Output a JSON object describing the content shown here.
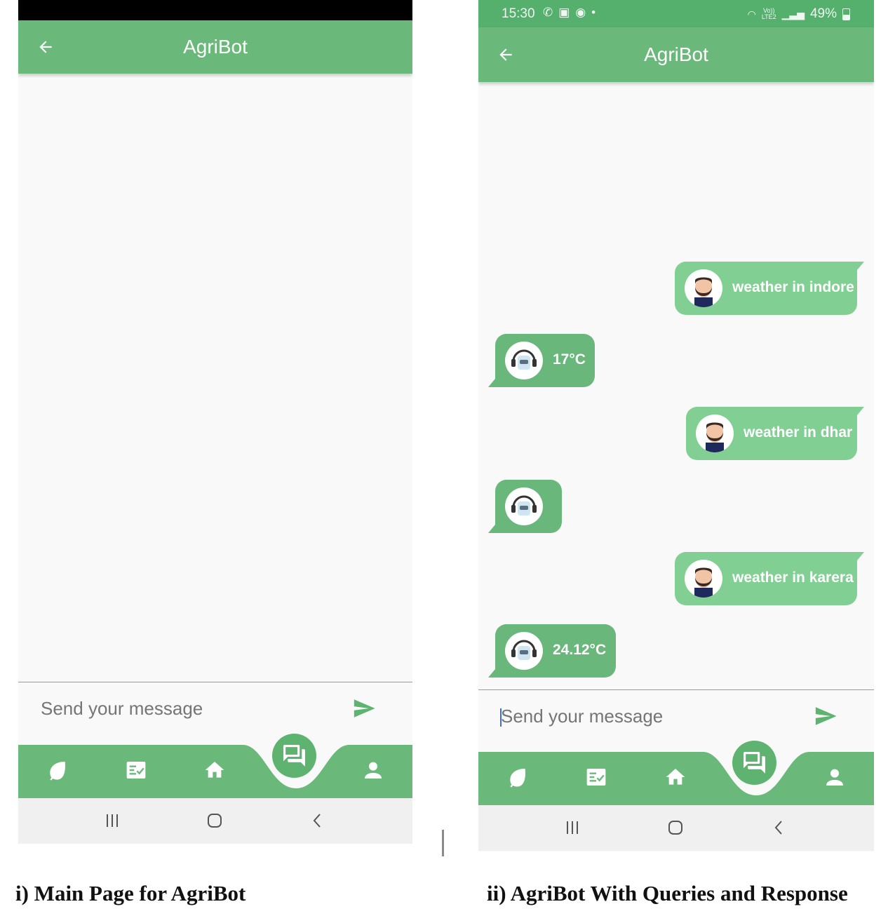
{
  "colors": {
    "appbar": "#6ab97b",
    "statusbar": "#56b06d",
    "user_bubble": "#82cf94",
    "bot_bubble": "#69b77b",
    "background": "#f9f9f9"
  },
  "screen1": {
    "appbar": {
      "title": "AgriBot",
      "back_icon": "arrow-left-icon"
    },
    "input": {
      "placeholder": "Send your message",
      "send_icon": "send-icon"
    },
    "nav": {
      "items": [
        "leaf-icon",
        "checklist-icon",
        "home-icon",
        "chat-icon",
        "person-icon"
      ],
      "active": "chat-icon"
    },
    "caption": "i) Main Page for AgriBot"
  },
  "screen2": {
    "status": {
      "time": "15:30",
      "volte": "Vo))",
      "lte": "LTE2",
      "battery": "49%"
    },
    "appbar": {
      "title": "AgriBot",
      "back_icon": "arrow-left-icon"
    },
    "messages": [
      {
        "sender": "user",
        "text": "weather in indore"
      },
      {
        "sender": "bot",
        "text": "17°C"
      },
      {
        "sender": "user",
        "text": "weather in dhar"
      },
      {
        "sender": "bot",
        "text": ""
      },
      {
        "sender": "user",
        "text": "weather in karera"
      },
      {
        "sender": "bot",
        "text": "24.12°C"
      }
    ],
    "input": {
      "placeholder": "Send your message",
      "send_icon": "send-icon"
    },
    "nav": {
      "items": [
        "leaf-icon",
        "checklist-icon",
        "home-icon",
        "chat-icon",
        "person-icon"
      ],
      "active": "chat-icon"
    },
    "caption": "ii) AgriBot With Queries and Response"
  }
}
